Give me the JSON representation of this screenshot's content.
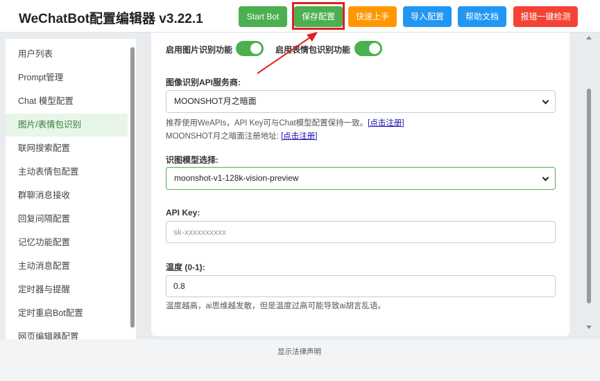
{
  "app": {
    "title": "WeChatBot配置编辑器 v3.22.1"
  },
  "header": {
    "buttons": {
      "start_bot": "Start Bot",
      "save": "保存配置",
      "quick_start": "快速上手",
      "import": "导入配置",
      "help": "帮助文档",
      "error_check": "报错一键检测"
    }
  },
  "sidebar": {
    "items": [
      {
        "label": "用户列表"
      },
      {
        "label": "Prompt管理"
      },
      {
        "label": "Chat 模型配置"
      },
      {
        "label": "图片/表情包识别",
        "active": true
      },
      {
        "label": "联网搜索配置"
      },
      {
        "label": "主动表情包配置"
      },
      {
        "label": "群聊消息接收"
      },
      {
        "label": "回复间隔配置"
      },
      {
        "label": "记忆功能配置"
      },
      {
        "label": "主动消息配置"
      },
      {
        "label": "定时器与提醒"
      },
      {
        "label": "定时重启Bot配置"
      },
      {
        "label": "网页编辑器配置"
      }
    ]
  },
  "main": {
    "toggles": {
      "image_recognition": {
        "label": "启用图片识别功能",
        "on": true
      },
      "sticker_recognition": {
        "label": "启用表情包识别功能",
        "on": true
      }
    },
    "api_provider": {
      "label": "图像识别API服务商:",
      "value": "MOONSHOT月之暗面",
      "help_prefix": "推荐使用WeAPIs，API Key可与Chat模型配置保持一致。",
      "help_link": "[点击注册]",
      "help2_prefix": "MOONSHOT月之暗面注册地址: ",
      "help2_link": "[点击注册]"
    },
    "model": {
      "label": "识图模型选择:",
      "value": "moonshot-v1-128k-vision-preview"
    },
    "api_key": {
      "label": "API Key:",
      "placeholder": "sk-xxxxxxxxxx"
    },
    "temperature": {
      "label": "温度 (0-1):",
      "value": "0.8",
      "help": "温度越高，ai思维越发散，但是温度过高可能导致ai胡言乱语。"
    }
  },
  "footer": {
    "legal_link": "显示法律声明"
  },
  "colors": {
    "accent_green": "#4caf50",
    "orange": "#ff9800",
    "blue": "#2196f3",
    "red": "#f44336",
    "highlight_red": "#e02020"
  }
}
